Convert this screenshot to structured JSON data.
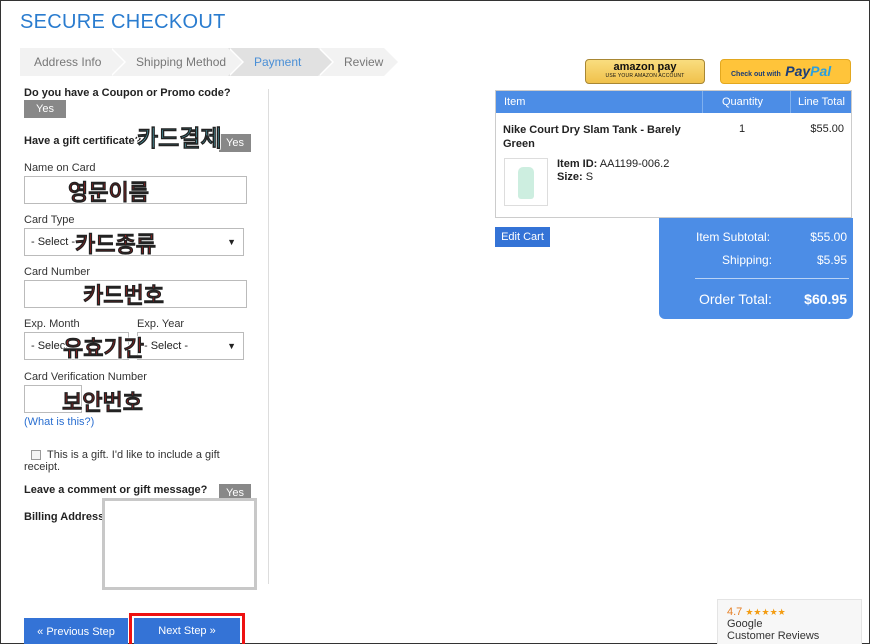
{
  "page": {
    "title": "SECURE CHECKOUT"
  },
  "steps": [
    "Address Info",
    "Shipping Method",
    "Payment",
    "Review"
  ],
  "form": {
    "coupon_label": "Do you have a Coupon or Promo code?",
    "coupon_yes": "Yes",
    "gift_cert_label": "Have a gift certificate?",
    "gift_cert_yes": "Yes",
    "name_on_card_label": "Name on Card",
    "card_type_label": "Card Type",
    "card_type_value": "- Select -",
    "card_number_label": "Card Number",
    "exp_month_label": "Exp. Month",
    "exp_month_value": "- Select -",
    "exp_year_label": "Exp. Year",
    "exp_year_value": "- Select -",
    "cvn_label": "Card Verification Number",
    "what_is_this": "(What is this?)",
    "gift_checkbox_text": "This is a gift. I'd like to include a gift receipt.",
    "comment_label": "Leave a comment or gift message?",
    "comment_yes": "Yes",
    "billing_label": "Billing Address"
  },
  "annotations": {
    "card_payment": "카드결제",
    "english_name": "영문이름",
    "card_type": "카드종류",
    "card_number": "카드번호",
    "expiry": "유효기간",
    "security_code": "보안번호"
  },
  "payment_buttons": {
    "amazon_main": "amazon pay",
    "amazon_sub": "USE YOUR AMAZON ACCOUNT",
    "paypal_prefix": "Check out with",
    "paypal_pay": "Pay",
    "paypal_pal": "Pal"
  },
  "cart": {
    "headers": {
      "item": "Item",
      "quantity": "Quantity",
      "line_total": "Line Total"
    },
    "item": {
      "name": "Nike Court Dry Slam Tank - Barely Green",
      "quantity": "1",
      "line_total": "$55.00",
      "item_id_label": "Item ID:",
      "item_id": "AA1199-006.2",
      "size_label": "Size:",
      "size": "S"
    },
    "edit_cart": "Edit Cart"
  },
  "totals": {
    "subtotal_label": "Item Subtotal:",
    "subtotal": "$55.00",
    "shipping_label": "Shipping:",
    "shipping": "$5.95",
    "order_total_label": "Order Total:",
    "order_total": "$60.95"
  },
  "nav": {
    "previous": "« Previous Step",
    "next": "Next Step »"
  },
  "google_reviews": {
    "rating": "4.7",
    "stars": "★★★★★",
    "line1": "Google",
    "line2": "Customer Reviews"
  }
}
